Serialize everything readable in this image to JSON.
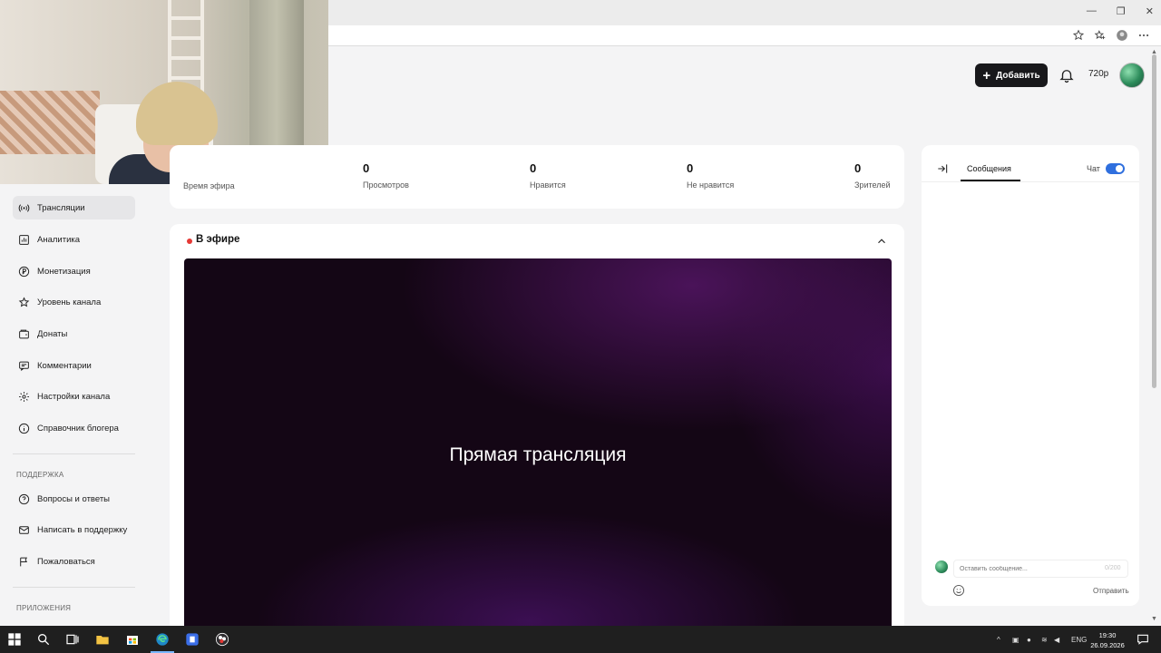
{
  "header": {
    "add_label": "Добавить",
    "quality": "720p"
  },
  "sidebar": {
    "items": [
      {
        "label": "Трансляции",
        "icon": "broadcast-icon",
        "active": true
      },
      {
        "label": "Аналитика",
        "icon": "analytics-icon"
      },
      {
        "label": "Монетизация",
        "icon": "ruble-icon"
      },
      {
        "label": "Уровень канала",
        "icon": "star-icon"
      },
      {
        "label": "Донаты",
        "icon": "wallet-icon"
      },
      {
        "label": "Комментарии",
        "icon": "comment-icon"
      },
      {
        "label": "Настройки канала",
        "icon": "gear-icon"
      },
      {
        "label": "Справочник блогера",
        "icon": "info-icon"
      }
    ],
    "support_heading": "ПОДДЕРЖКА",
    "support_items": [
      {
        "label": "Вопросы и ответы",
        "icon": "question-icon"
      },
      {
        "label": "Написать в поддержку",
        "icon": "mail-icon"
      },
      {
        "label": "Пожаловаться",
        "icon": "flag-icon"
      }
    ],
    "apps_heading": "ПРИЛОЖЕНИЯ"
  },
  "stats": [
    {
      "value": "",
      "label": "Время эфира"
    },
    {
      "value": "0",
      "label": "Просмотров"
    },
    {
      "value": "0",
      "label": "Нравится"
    },
    {
      "value": "0",
      "label": "Не нравится"
    },
    {
      "value": "0",
      "label": "Зрителей"
    }
  ],
  "live": {
    "title": "В эфире",
    "player_text": "Прямая трансляция"
  },
  "chat": {
    "tab_messages": "Сообщения",
    "chat_label": "Чат",
    "chat_enabled": true,
    "input_placeholder": "Оставить сообщение...",
    "counter": "0/200",
    "send_label": "Отправить"
  },
  "taskbar": {
    "lang": "ENG",
    "time": "19:30",
    "date": "26.09.2026"
  },
  "colors": {
    "accent": "#2f6fde",
    "live_dot": "#e53935",
    "dark_button": "#18181b",
    "player_bg": "#140615"
  }
}
